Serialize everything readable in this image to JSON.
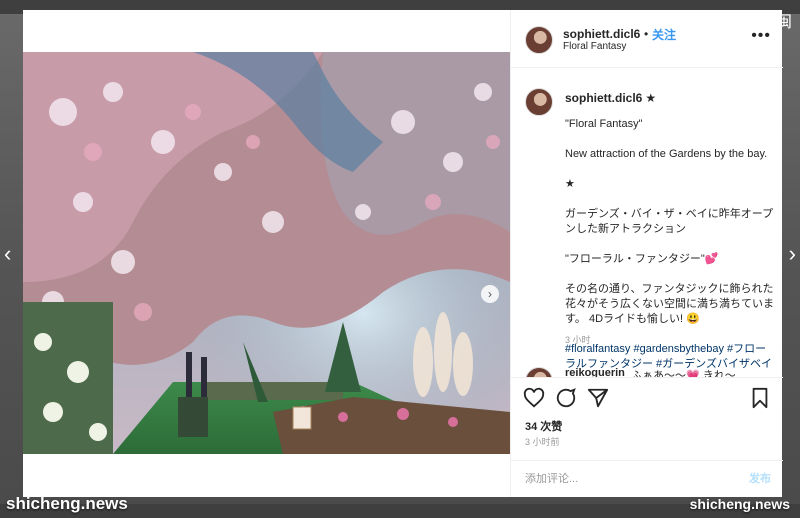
{
  "watermark": {
    "left": "shicheng.news",
    "right": "shicheng.news"
  },
  "corner_glyph": "闽",
  "nav": {
    "prev": "‹",
    "next": "›",
    "photo_next": "›"
  },
  "post": {
    "username": "sophiett.dicl6",
    "dot": "•",
    "follow": "关注",
    "location": "Floral Fantasy",
    "more": "•••"
  },
  "caption": {
    "username": "sophiett.dicl6",
    "star": "★",
    "lines": [
      {
        "text": "\"Floral Fantasy\"",
        "tag": false
      },
      {
        "text": "New attraction of the Gardens by the bay.",
        "tag": false
      },
      {
        "text": "★",
        "tag": false
      },
      {
        "text": "ガーデンズ・バイ・ザ・ベイに昨年オープンした新アトラクション",
        "tag": false
      },
      {
        "text": "\"フローラル・ファンタジー\"💕",
        "tag": false
      },
      {
        "text": "その名の通り、ファンタジックに飾られた花々がそう広くない空間に満ち満ちています。 4Dライドも愉しい! 😃",
        "tag": false
      },
      {
        "text": "#floralfantasy #gardensbythebay #フローラルファンタジー #ガーデンズバイザベイ #花々 #flowers #fantastic #ファインダー越しの世界 #travel #シンガポール #singapore",
        "tag": true
      }
    ],
    "time": "3 小时"
  },
  "comment": {
    "username": "reikoguerin",
    "text": "ふぁあ〜〜💗 きれ〜"
  },
  "actions": {
    "likes": "34 次赞",
    "time": "3 小时前"
  },
  "add_comment": {
    "placeholder": "添加评论...",
    "post": "发布"
  },
  "colors": {
    "accent": "#3897f0",
    "text": "#262626",
    "muted": "#999999"
  }
}
